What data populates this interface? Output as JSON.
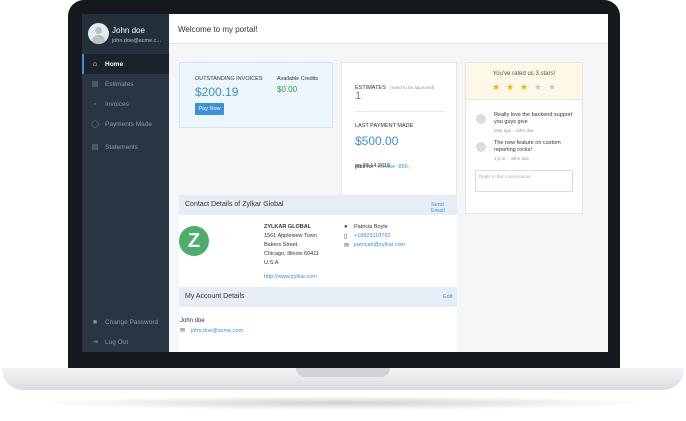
{
  "profile": {
    "name": "John doe",
    "email": "john.doe@acme.c..."
  },
  "sidebar": {
    "items": [
      {
        "label": "Home",
        "icon": "home-icon"
      },
      {
        "label": "Estimates",
        "icon": "estimates-icon"
      },
      {
        "label": "Invoices",
        "icon": "invoices-icon"
      },
      {
        "label": "Payments Made",
        "icon": "payments-icon"
      },
      {
        "label": "Statements",
        "icon": "statements-icon"
      }
    ],
    "bottom": [
      {
        "label": "Change Password",
        "icon": "lock-icon"
      },
      {
        "label": "Log Out",
        "icon": "logout-icon"
      }
    ]
  },
  "header": {
    "title": "Welcome to my portal!"
  },
  "summary": {
    "outstanding_label": "OUTSTANDING INVOICES",
    "outstanding_value": "$200.19",
    "credits_label": "Available Credits",
    "credits_value": "$0.00",
    "pay_button": "Pay Now"
  },
  "estimates": {
    "label": "ESTIMATES",
    "note": "(need to be approved)",
    "count": "1",
    "last_payment_label": "LAST PAYMENT MADE",
    "last_payment_value": "$500.00",
    "paid_for_prefix": "paid for",
    "invoice_link": "Invoice -856,",
    "paid_on": "on 09.14.2015."
  },
  "rating": {
    "text": "You've rated us 3 stars!",
    "value": 3,
    "max": 5,
    "comments": [
      {
        "text": "Really love the backend support you guys give",
        "meta": "May ago - John doe"
      },
      {
        "text": "The new feature on custom reporting rocks!",
        "meta": "3 p.m. - John doe"
      }
    ],
    "reply_placeholder": "Reply to this conversation"
  },
  "contact": {
    "title": "Contact Details of Zylkar Global",
    "action": "Send Email",
    "company": "ZYLKAR GLOBAL",
    "address1": "1561 Appleview Town",
    "address2": "Bakers Street",
    "address3": "Chicago, Illinois 60411",
    "country": "U.S.A",
    "website": "http://www.zylkar.com",
    "person": "Patricia Boyle",
    "phone": "+18829118792",
    "email": "patricab@zylkar.com",
    "logo_letter": "Z",
    "logo_color": "#4cae6a"
  },
  "account": {
    "title": "My Account Details",
    "action": "Edit",
    "name": "John doe",
    "email": "john.doe@acme.com"
  },
  "colors": {
    "accent": "#3d8fe0",
    "sidebar": "#283542",
    "green": "#2a9a3c"
  }
}
